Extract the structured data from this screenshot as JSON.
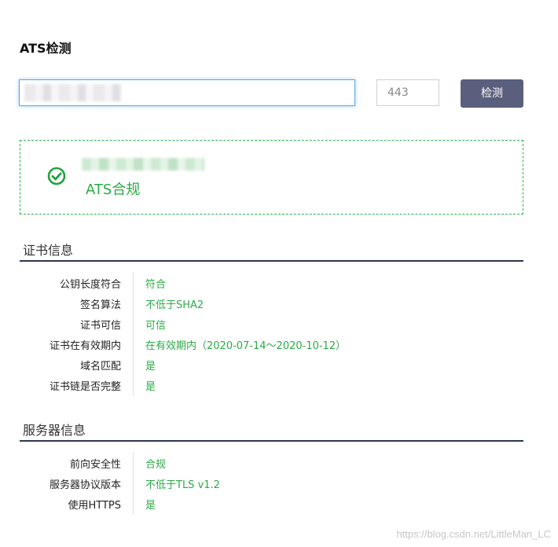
{
  "page": {
    "title": "ATS检测"
  },
  "search": {
    "domain_value": "",
    "port_value": "443",
    "detect_label": "检测"
  },
  "result": {
    "status_text": "ATS合规",
    "status_color": "#2aaa45",
    "border_color": "#2db34a",
    "icon": "check-circle-icon"
  },
  "certificate": {
    "title": "证书信息",
    "rows": [
      {
        "label": "公钥长度符合",
        "value": "符合"
      },
      {
        "label": "签名算法",
        "value": "不低于SHA2"
      },
      {
        "label": "证书可信",
        "value": "可信"
      },
      {
        "label": "证书在有效期内",
        "value": "在有效期内（2020-07-14～2020-10-12）"
      },
      {
        "label": "域名匹配",
        "value": "是"
      },
      {
        "label": "证书链是否完整",
        "value": "是"
      }
    ]
  },
  "server": {
    "title": "服务器信息",
    "rows": [
      {
        "label": "前向安全性",
        "value": "合规"
      },
      {
        "label": "服务器协议版本",
        "value": "不低于TLS v1.2"
      },
      {
        "label": "使用HTTPS",
        "value": "是"
      }
    ]
  },
  "colors": {
    "button_bg": "#5a5f7d",
    "section_rule": "#2c3650",
    "input_focus": "#5aa6e6"
  },
  "watermark": "https://blog.csdn.net/LittleMan_LC"
}
